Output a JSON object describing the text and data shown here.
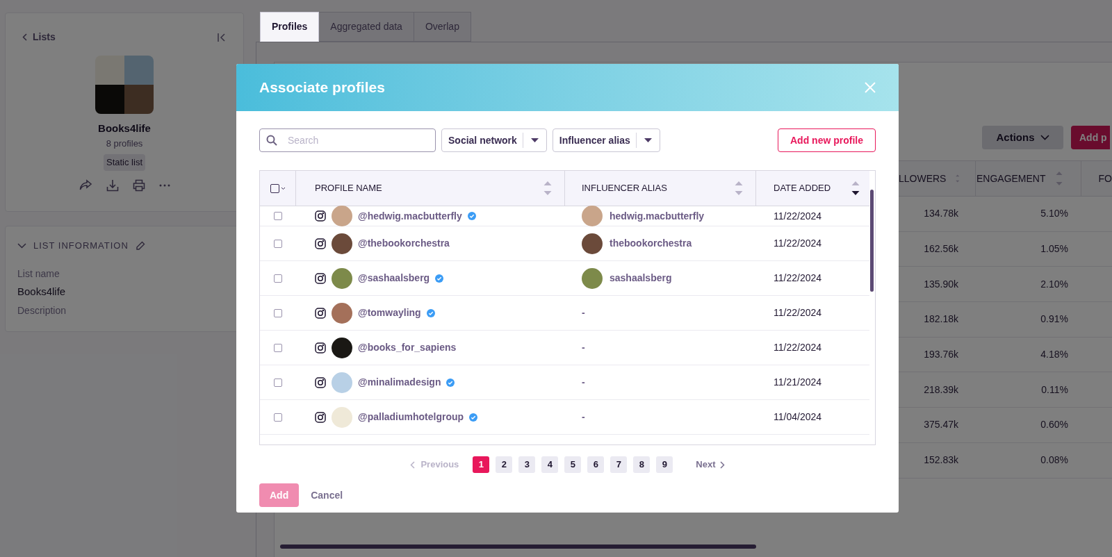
{
  "sidebar": {
    "back_link": "Lists",
    "list_name": "Books4life",
    "profile_count": "8 profiles",
    "list_type": "Static list"
  },
  "list_information": {
    "title": "LIST INFORMATION",
    "expanded": true,
    "fields": [
      {
        "label": "List name",
        "value": "Books4life"
      },
      {
        "label": "Description"
      }
    ]
  },
  "tabs": [
    {
      "label": "Profiles",
      "selected": true
    },
    {
      "label": "Aggregated data",
      "selected": false
    },
    {
      "label": "Overlap",
      "selected": false
    }
  ],
  "toolbar": {
    "actions": "Actions",
    "add": "Add p"
  },
  "background_table": {
    "columns": [
      "LLOWERS",
      "ENGAGEMENT",
      "FO"
    ],
    "rows": [
      [
        "134.78k",
        "5.10%"
      ],
      [
        "162.56k",
        "1.05%"
      ],
      [
        "135.90k",
        "2.10%"
      ],
      [
        "182.18k",
        "0.91%"
      ],
      [
        "193.76k",
        "4.18%"
      ],
      [
        "218.39k",
        "0.11%"
      ],
      [
        "375.47k",
        "0.60%"
      ],
      [
        "152.83k",
        "0.08%"
      ]
    ]
  },
  "modal": {
    "title": "Associate profiles",
    "search": {
      "placeholder": "Search"
    },
    "filters": [
      "Social network",
      "Influencer alias"
    ],
    "add_new": "Add new profile",
    "select_all": {
      "checked": false
    },
    "columns": [
      {
        "label": "PROFILE NAME",
        "sorted": false
      },
      {
        "label": "INFLUENCER ALIAS",
        "sorted": false
      },
      {
        "label": "DATE ADDED",
        "sorted": true
      }
    ],
    "rows": [
      {
        "checked": false,
        "handle": "@hedwig.macbutterfly",
        "verified": true,
        "alias": "hedwig.macbutterfly",
        "alias_avatar": true,
        "date": "11/22/2024"
      },
      {
        "checked": false,
        "handle": "@thebookorchestra",
        "verified": false,
        "alias": "thebookorchestra",
        "alias_avatar": true,
        "date": "11/22/2024"
      },
      {
        "checked": false,
        "handle": "@sashaalsberg",
        "verified": true,
        "alias": "sashaalsberg",
        "alias_avatar": true,
        "date": "11/22/2024"
      },
      {
        "checked": false,
        "handle": "@tomwayling",
        "verified": true,
        "alias": "-",
        "alias_avatar": false,
        "date": "11/22/2024"
      },
      {
        "checked": false,
        "handle": "@books_for_sapiens",
        "verified": false,
        "alias": "-",
        "alias_avatar": false,
        "date": "11/22/2024"
      },
      {
        "checked": false,
        "handle": "@minalimadesign",
        "verified": true,
        "alias": "-",
        "alias_avatar": false,
        "date": "11/21/2024"
      },
      {
        "checked": false,
        "handle": "@palladiumhotelgroup",
        "verified": true,
        "alias": "-",
        "alias_avatar": false,
        "date": "11/04/2024"
      }
    ],
    "pagination": {
      "previous": {
        "label": "Previous",
        "disabled": true
      },
      "next": {
        "label": "Next",
        "disabled": false
      },
      "pages": [
        {
          "label": "1",
          "selected": true
        },
        {
          "label": "2",
          "selected": false
        },
        {
          "label": "3",
          "selected": false
        },
        {
          "label": "4",
          "selected": false
        },
        {
          "label": "5",
          "selected": false
        },
        {
          "label": "6",
          "selected": false
        },
        {
          "label": "7",
          "selected": false
        },
        {
          "label": "8",
          "selected": false
        },
        {
          "label": "9",
          "selected": false
        }
      ]
    },
    "add_button": {
      "label": "Add",
      "disabled": true
    },
    "cancel": "Cancel"
  }
}
